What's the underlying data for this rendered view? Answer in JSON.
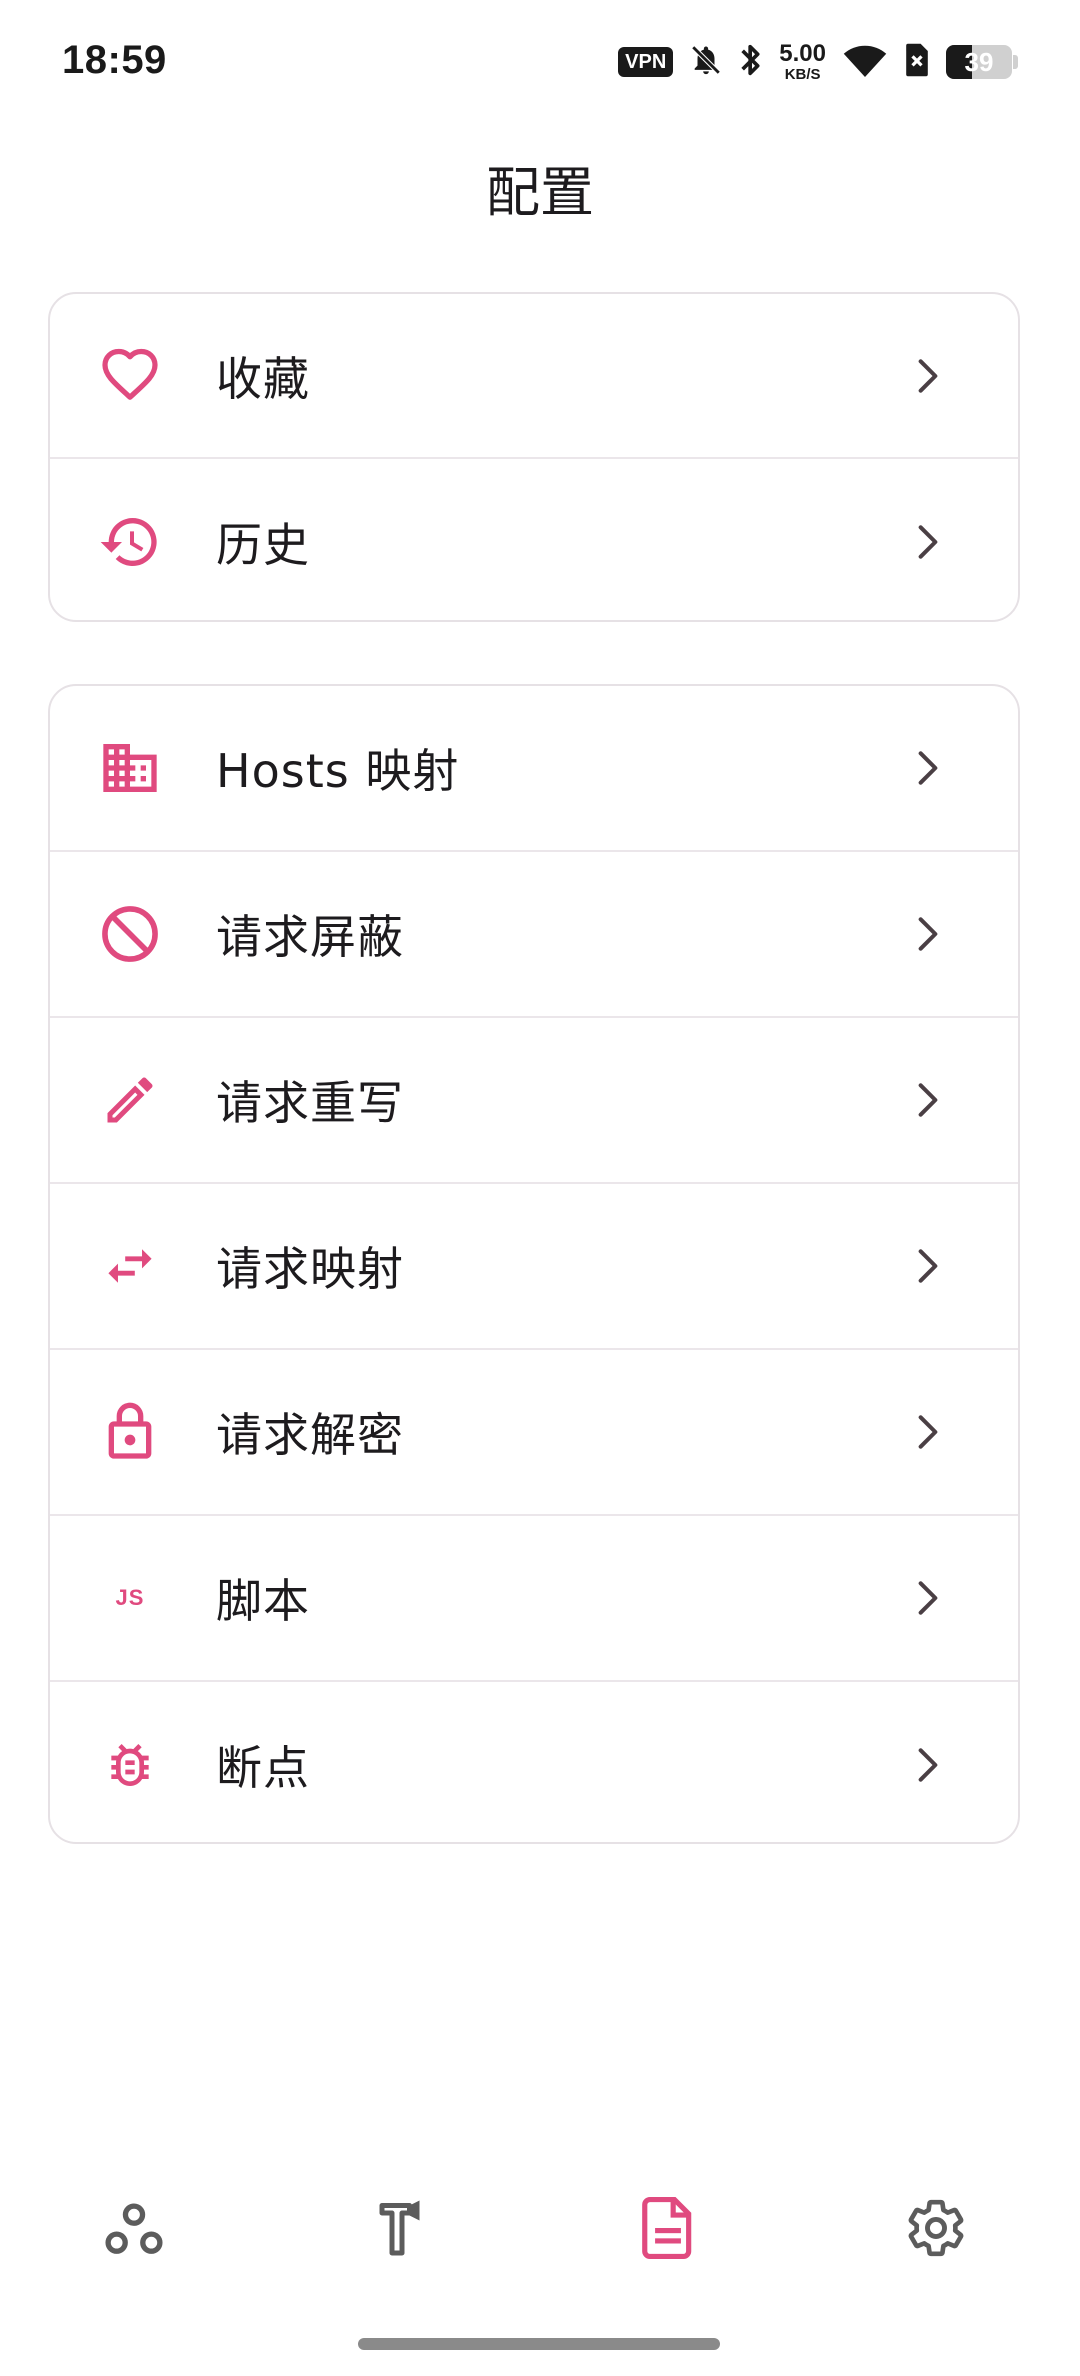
{
  "status_bar": {
    "time": "18:59",
    "vpn_label": "VPN",
    "speed_value": "5.00",
    "speed_unit": "KB/S",
    "battery_level": "39",
    "battery_fraction": 0.39,
    "icons": [
      "vpn-badge",
      "bell-off-icon",
      "bluetooth-icon",
      "network-speed",
      "wifi-icon",
      "sim-x-icon",
      "battery-icon"
    ]
  },
  "header": {
    "title": "配置"
  },
  "colors": {
    "accent": "#e04a7f",
    "chevron": "#4a3f44",
    "nav_inactive": "#5c5c5c",
    "divider": "#ebe6ea"
  },
  "groups": [
    {
      "items": [
        {
          "label": "收藏",
          "icon": "heart-icon"
        },
        {
          "label": "历史",
          "icon": "history-icon"
        }
      ]
    },
    {
      "items": [
        {
          "label": "Hosts 映射",
          "icon": "domain-icon"
        },
        {
          "label": "请求屏蔽",
          "icon": "block-icon"
        },
        {
          "label": "请求重写",
          "icon": "edit-pencil-icon"
        },
        {
          "label": "请求映射",
          "icon": "swap-arrows-icon"
        },
        {
          "label": "请求解密",
          "icon": "lock-icon"
        },
        {
          "label": "脚本",
          "icon": "js-icon",
          "icon_text": "JS"
        },
        {
          "label": "断点",
          "icon": "bug-icon"
        }
      ]
    }
  ],
  "bottom_nav": {
    "items": [
      {
        "name": "network",
        "icon": "network-nodes-icon",
        "active": false
      },
      {
        "name": "toolbox",
        "icon": "hammer-icon",
        "active": false
      },
      {
        "name": "config",
        "icon": "document-icon",
        "active": true
      },
      {
        "name": "settings",
        "icon": "gear-icon",
        "active": false
      }
    ]
  }
}
